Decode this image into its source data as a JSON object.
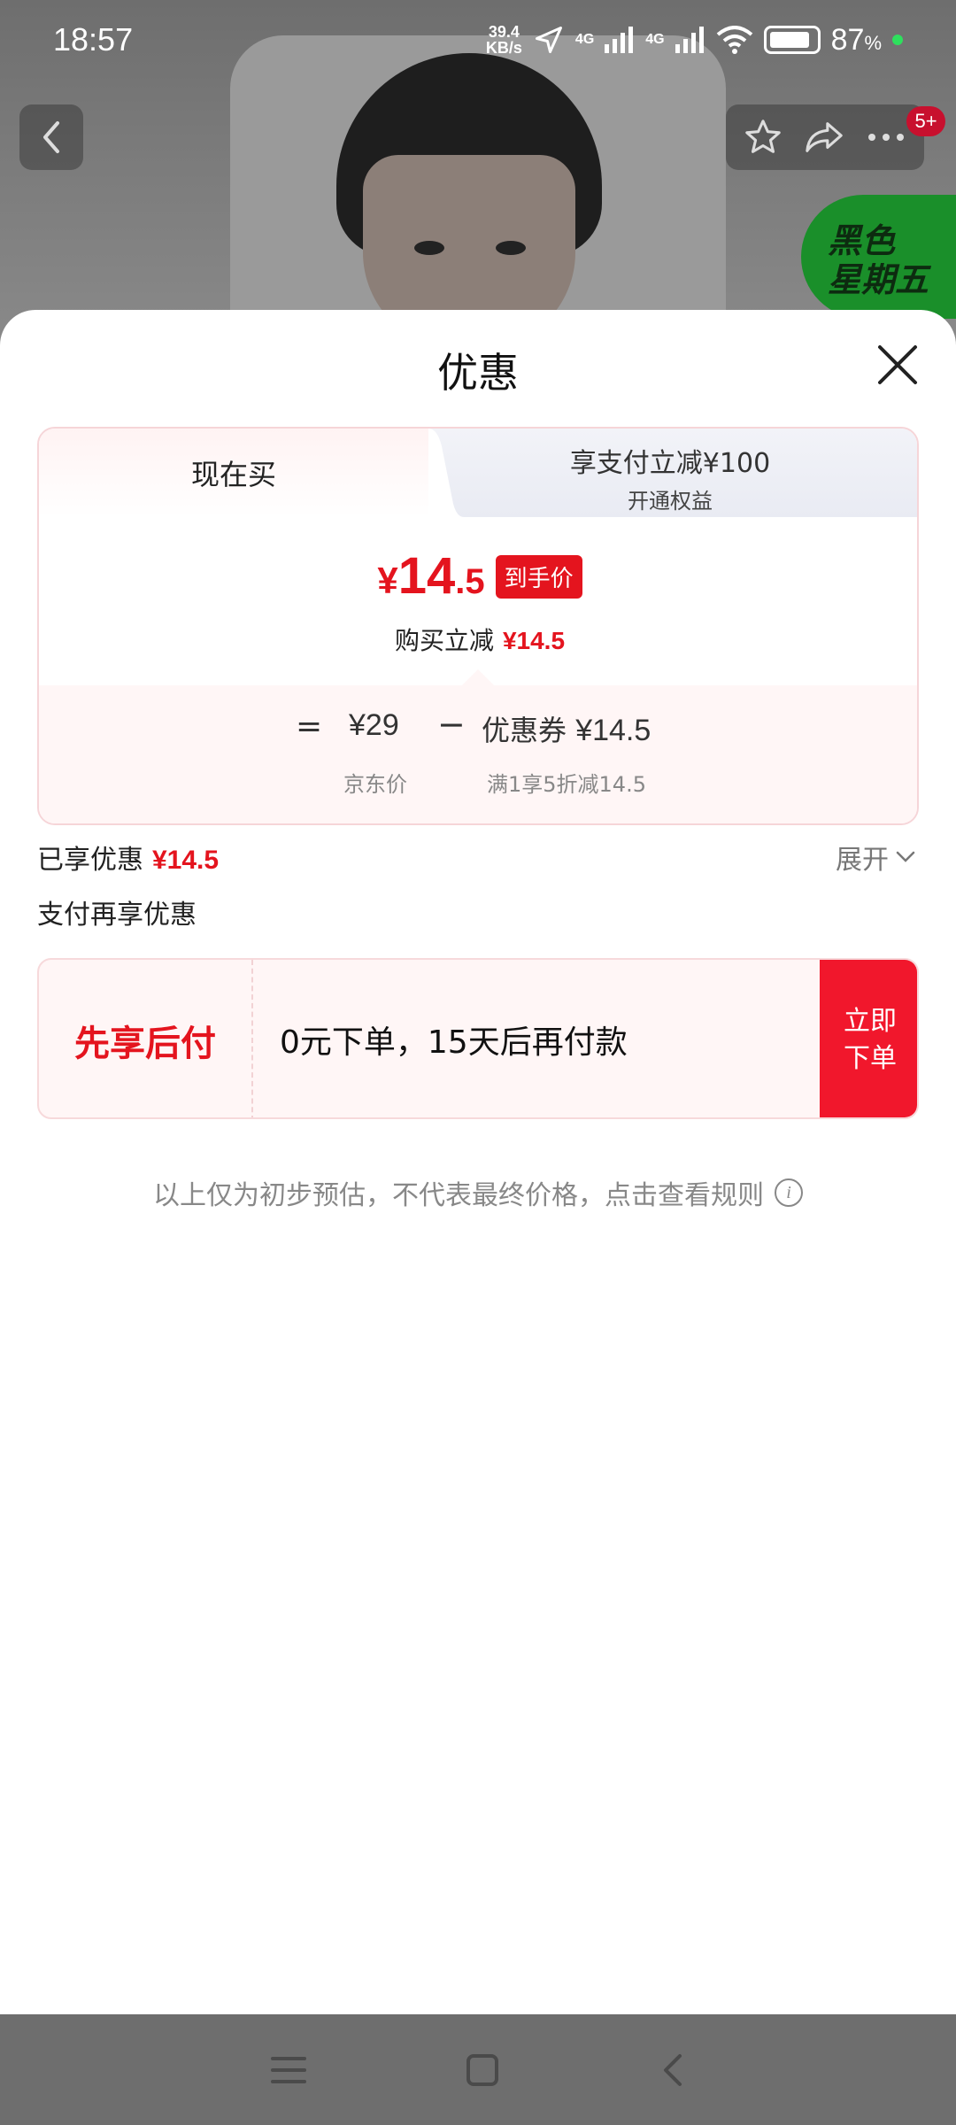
{
  "status_bar": {
    "time": "18:57",
    "net_speed_value": "39.4",
    "net_speed_unit": "KB/s",
    "sim1_label": "4G",
    "sim2_label": "4G",
    "battery_pct": "87",
    "battery_pct_unit": "%"
  },
  "top_nav": {
    "cart_badge": "5+",
    "promo_badge_line1": "黑色",
    "promo_badge_line2": "星期五"
  },
  "sheet": {
    "title": "优惠",
    "tabs": [
      {
        "label": "现在买",
        "active": true
      },
      {
        "label": "享支付立减¥100",
        "sublabel": "开通权益",
        "active": false
      }
    ],
    "final_price": {
      "yen": "¥",
      "int": "14",
      "dec": ".5",
      "tag": "到手价"
    },
    "instant_reduce": {
      "label": "购买立减",
      "value": "¥14.5"
    },
    "formula": {
      "eq": "=",
      "jd_price": "¥29",
      "minus": "−",
      "coupon_label": "优惠券",
      "coupon_value": "¥14.5",
      "jd_price_label": "京东价",
      "coupon_desc": "满1享5折减14.5"
    },
    "enjoyed": {
      "label": "已享优惠",
      "value": "¥14.5",
      "expand": "展开"
    },
    "pay_more_label": "支付再享优惠",
    "bnpl": {
      "title": "先享后付",
      "desc": "0元下单，15天后再付款",
      "button_line1": "立即",
      "button_line2": "下单"
    },
    "disclaimer": "以上仅为初步预估，不代表最终价格，点击查看规则",
    "info_icon_glyph": "i"
  },
  "colors": {
    "accent_red": "#e4141e",
    "button_red": "#f1172c",
    "promo_green": "#1a8f2a"
  }
}
